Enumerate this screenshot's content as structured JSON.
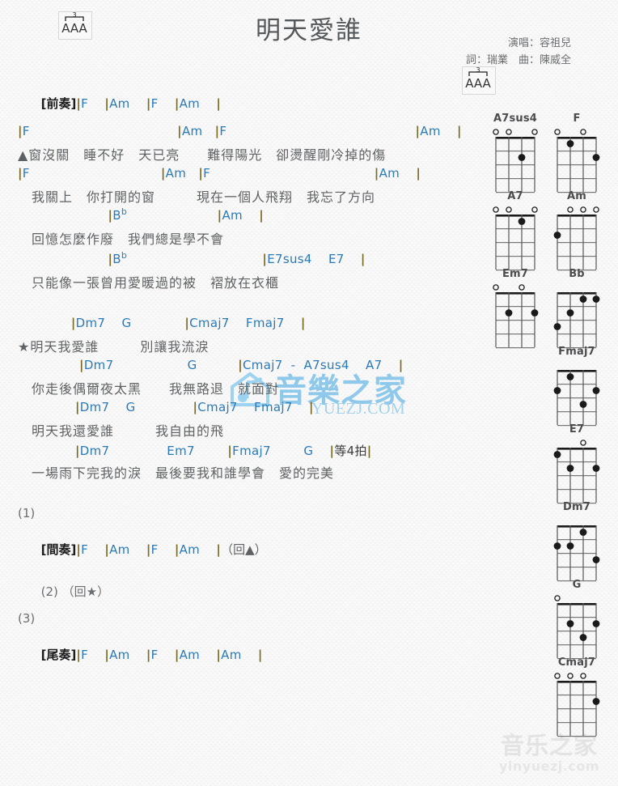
{
  "header": {
    "title": "明天愛誰",
    "singer": "演唱：容祖兒",
    "writers": "詞：瑞業　曲：陳威全",
    "strum_pattern": "AAA",
    "strum_triplet": "3"
  },
  "watermarks": {
    "center_cn": "音樂之家",
    "center_url": "YUEZJ.COM",
    "footer_cn": "音乐之家",
    "footer_url": "yinyuezj.com"
  },
  "colors": {
    "chord": "#2b7ab8",
    "bar": "#7b6a23",
    "lyric": "#5f6264",
    "title": "#55585b",
    "dot": "#1a1a1a"
  },
  "intro": {
    "label": "[前奏]",
    "chords": "|F    |Am    |F    |Am    |"
  },
  "verses": [
    {
      "chords": "|F                                    |Am   |F                                              |Am    |",
      "lyric": "▲窗沒關　睡不好　天已亮　　難得陽光　卻燙醒剛冷掉的傷"
    },
    {
      "chords": "|F                                |Am   |F                                        |Am    |",
      "lyric": "　我關上　你打開的窗　　　現在一個人飛翔　我忘了方向"
    },
    {
      "chords": "                      |B♭                      |Am    |",
      "lyric": "　回憶怎麼作廢　我們總是學不會"
    },
    {
      "chords": "                      |B♭                                 |E7sus4    E7    |",
      "lyric": "　只能像一張曾用愛暖過的被　褶放在衣櫃"
    }
  ],
  "chorus": [
    {
      "chords": "             |Dm7    G             |Cmaj7    Fmaj7    |",
      "lyric": "★明天我愛誰　　　別讓我流淚"
    },
    {
      "chords": "               |Dm7                  G          |Cmaj7  -  A7sus4    A7    |",
      "lyric": "　你走後偶爾夜太黑　　我無路退　就面對"
    },
    {
      "chords": "              |Dm7    G              |Cmaj7    Fmaj7    |",
      "lyric": "　明天我還愛誰　　　我自由的飛"
    },
    {
      "chords": "              |Dm7              Em7        |Fmaj7        G    |等4拍|",
      "lyric": "　一場雨下完我的淚　最後要我和誰學會　愛的完美"
    }
  ],
  "endings": [
    {
      "number": "(1)",
      "label": "[間奏]",
      "chords": "|F    |Am    |F    |Am    |",
      "note": "（回▲）"
    },
    {
      "number": "(2)",
      "label": "",
      "chords": "",
      "note": "（回★）"
    },
    {
      "number": "(3)",
      "label": "[尾奏]",
      "chords": "|F    |Am    |F    |Am    |Am    |",
      "note": ""
    }
  ],
  "chord_diagrams": [
    {
      "name": "A7sus4",
      "open": [
        1,
        3,
        4
      ],
      "dots": [
        {
          "string": 2,
          "fret": 2
        }
      ]
    },
    {
      "name": "F",
      "open": [
        2,
        4
      ],
      "dots": [
        {
          "string": 3,
          "fret": 1
        },
        {
          "string": 1,
          "fret": 2
        }
      ]
    },
    {
      "name": "A7",
      "open": [
        1,
        3,
        4
      ],
      "dots": [
        {
          "string": 2,
          "fret": 1
        }
      ]
    },
    {
      "name": "Am",
      "open": [
        1,
        2,
        3
      ],
      "dots": [
        {
          "string": 4,
          "fret": 2
        }
      ]
    },
    {
      "name": "Em7",
      "open": [
        2,
        4
      ],
      "dots": [
        {
          "string": 3,
          "fret": 2
        },
        {
          "string": 1,
          "fret": 2
        }
      ]
    },
    {
      "name": "Bb",
      "open": [],
      "dots": [
        {
          "string": 4,
          "fret": 3
        },
        {
          "string": 3,
          "fret": 2
        },
        {
          "string": 2,
          "fret": 1
        },
        {
          "string": 1,
          "fret": 1
        }
      ]
    },
    {
      "name": "Fmaj7",
      "open": [],
      "dots": [
        {
          "string": 4,
          "fret": 2
        },
        {
          "string": 3,
          "fret": 1
        },
        {
          "string": 2,
          "fret": 3
        },
        {
          "string": 1,
          "fret": 2
        }
      ]
    },
    {
      "name": "E7",
      "open": [
        2
      ],
      "dots": [
        {
          "string": 4,
          "fret": 1
        },
        {
          "string": 3,
          "fret": 2
        },
        {
          "string": 1,
          "fret": 2
        }
      ]
    },
    {
      "name": "Dm7",
      "open": [],
      "dots": [
        {
          "string": 4,
          "fret": 2
        },
        {
          "string": 3,
          "fret": 2
        },
        {
          "string": 2,
          "fret": 1
        },
        {
          "string": 1,
          "fret": 3
        }
      ]
    },
    {
      "name": "G",
      "open": [
        4
      ],
      "dots": [
        {
          "string": 3,
          "fret": 2
        },
        {
          "string": 2,
          "fret": 3
        },
        {
          "string": 1,
          "fret": 2
        }
      ]
    },
    {
      "name": "Cmaj7",
      "open": [
        2,
        3,
        4
      ],
      "dots": [
        {
          "string": 1,
          "fret": 2
        }
      ]
    }
  ]
}
